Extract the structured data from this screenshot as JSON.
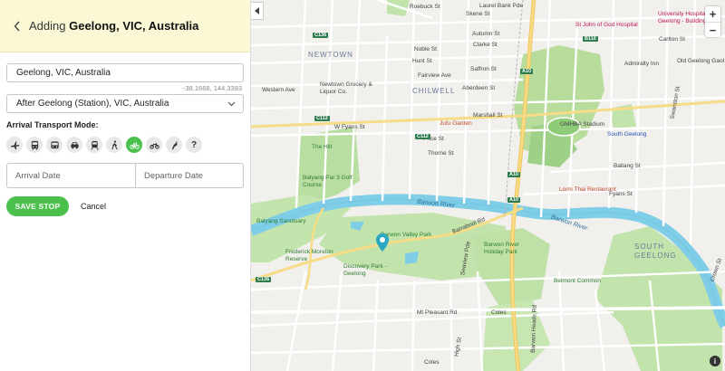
{
  "panel": {
    "title_prefix": "Adding",
    "title_place": "Geelong, VIC, Australia",
    "place_value": "Geelong, VIC, Australia",
    "coordinates": "-38.1668, 144.3393",
    "after_select": "After Geelong (Station), VIC, Australia",
    "mode_label": "Arrival Transport Mode:",
    "modes": [
      {
        "icon": "plane-icon"
      },
      {
        "icon": "bus-icon"
      },
      {
        "icon": "coach-icon"
      },
      {
        "icon": "car-icon"
      },
      {
        "icon": "train-icon"
      },
      {
        "icon": "walk-icon"
      },
      {
        "icon": "bicycle-icon",
        "active": true
      },
      {
        "icon": "motorbike-icon"
      },
      {
        "icon": "hitchhike-icon"
      },
      {
        "icon": "unknown-icon",
        "text": "?"
      }
    ],
    "arrival_placeholder": "Arrival Date",
    "departure_placeholder": "Departure Date",
    "save_label": "SAVE STOP",
    "cancel_label": "Cancel"
  },
  "map": {
    "zoom_in": "+",
    "zoom_out": "−",
    "info": "i",
    "accent_green": "#4cc04c",
    "labels": {
      "newtown": "NEWTOWN",
      "chilwell": "CHILWELL",
      "south_geelong": "SOUTH GEELONG",
      "barwon_river_1": "Barwon River",
      "barwon_river_2": "Barwon River",
      "noble_st": "Noble St",
      "aberdeen_st": "Aberdeen St",
      "pakington_st": "Pakington St",
      "newtown_grocery": "Newtown Grocery & Liquor Co.",
      "the_hill": "The Hill",
      "balyang_par3": "Balyang Par 3 Golf Course",
      "balyang_sanctuary": "Balyang Sanctuary",
      "barwon_valley_park": "Barwon Valley Park",
      "frederick_moreton": "Frederick Moreton Reserve",
      "discovery_park": "Discovery Park - Geelong",
      "barwon_river_holiday": "Barwon River Holiday Park",
      "belmont_common": "Belmont Common",
      "jufu_garden": "Jufu Garden",
      "gmhba": "GMHBA Stadium",
      "lorm_thai": "Lorm Thai Restaurant",
      "south_geelong_stn": "South Geelong",
      "st_john": "St John of God Hospital",
      "univ_hosp": "University Hospital Geelong - Building",
      "admiralty": "Admiralty Inn",
      "old_geelong": "Old Geelong Gaol",
      "coles_1": "Coles",
      "coles_2": "Coles",
      "mt_pleasant": "Mt Pleasant Rd",
      "barrabool": "Barrabool Rd",
      "w_fyans": "W Fyans St",
      "fyans_st": "Fyans St",
      "verner_st": "Verner St",
      "carr_st": "Carr St",
      "roebuck": "Roebuck St",
      "laurel_bank": "Laurel Bank Pde",
      "ballarat": "Ballarat Pde",
      "skene_st": "Skene St",
      "shannon_ave": "Shannon Ave",
      "clarke_st": "Clarke St",
      "fairview": "Fairview Ave",
      "autumn_st": "Autumn St",
      "hunt_st": "Hunt St",
      "saffron": "Saffron St",
      "price_st": "Price St",
      "thorne": "Thorne St",
      "gordon": "Gordon Ave",
      "western_ave": "Western Ave",
      "latrobe": "Latrobe Tce",
      "crossley": "Crossley St",
      "hope_st": "Hope St",
      "carlton_st": "Carlton St",
      "marshall": "Marshall St",
      "swanston": "Swanston St",
      "ballarat_rd": "Ballang St",
      "eastern_st": "Eastern Park",
      "scotsburn": "Seaview Pde",
      "high_st": "High St",
      "barwon_hds": "Barwon Heads Rd",
      "fyans_sign": "Fyans St",
      "crown_st": "Crown St"
    },
    "shields": [
      "C136",
      "C112",
      "A10",
      "B110",
      "C108",
      "C111",
      "C112",
      "B110",
      "A10",
      "A10",
      "C138",
      "C136",
      "C112"
    ]
  }
}
